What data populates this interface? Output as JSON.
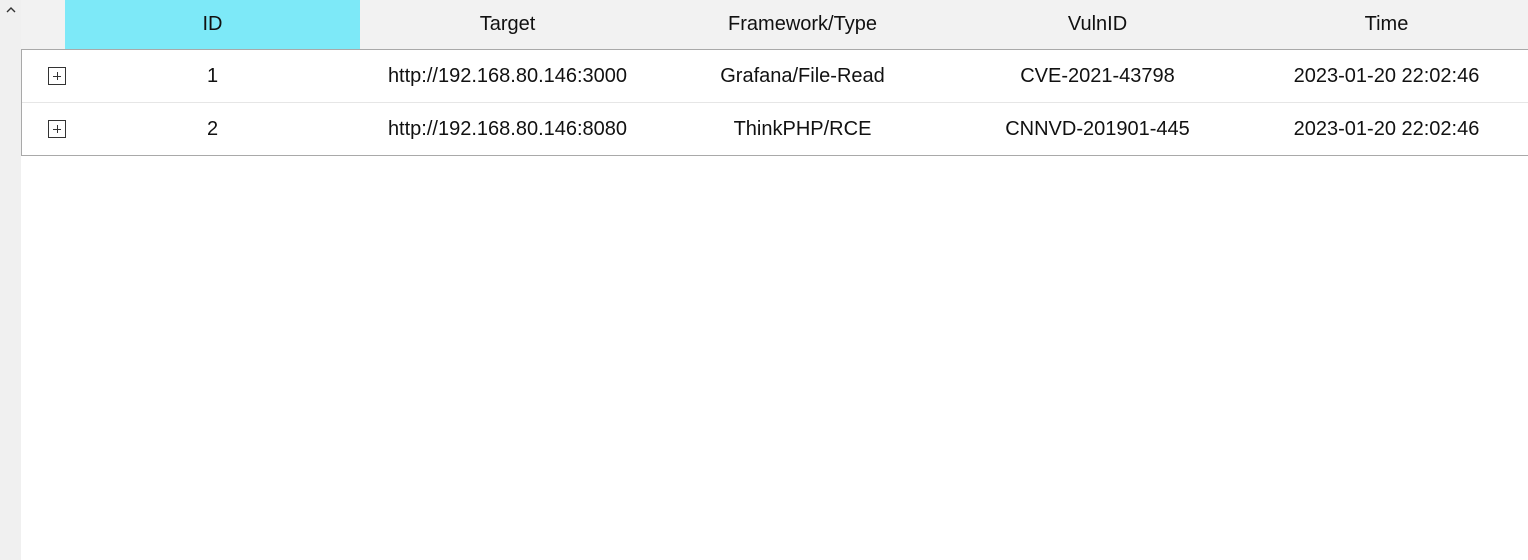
{
  "table": {
    "headers": {
      "id": "ID",
      "target": "Target",
      "framework": "Framework/Type",
      "vulnid": "VulnID",
      "time": "Time"
    },
    "selected_header": "ID",
    "rows": [
      {
        "id": "1",
        "target": "http://192.168.80.146:3000",
        "framework": "Grafana/File-Read",
        "vulnid": "CVE-2021-43798",
        "time": "2023-01-20 22:02:46"
      },
      {
        "id": "2",
        "target": "http://192.168.80.146:8080",
        "framework": "ThinkPHP/RCE",
        "vulnid": "CNNVD-201901-445",
        "time": "2023-01-20 22:02:46"
      }
    ]
  },
  "icons": {
    "scroll_up": "chevron-up-icon",
    "row_expander": "plus-box-icon"
  },
  "colors": {
    "header_selected": "#7de9f8",
    "header_bg": "#f2f2f2",
    "gutter_bg": "#f0f0f0"
  }
}
